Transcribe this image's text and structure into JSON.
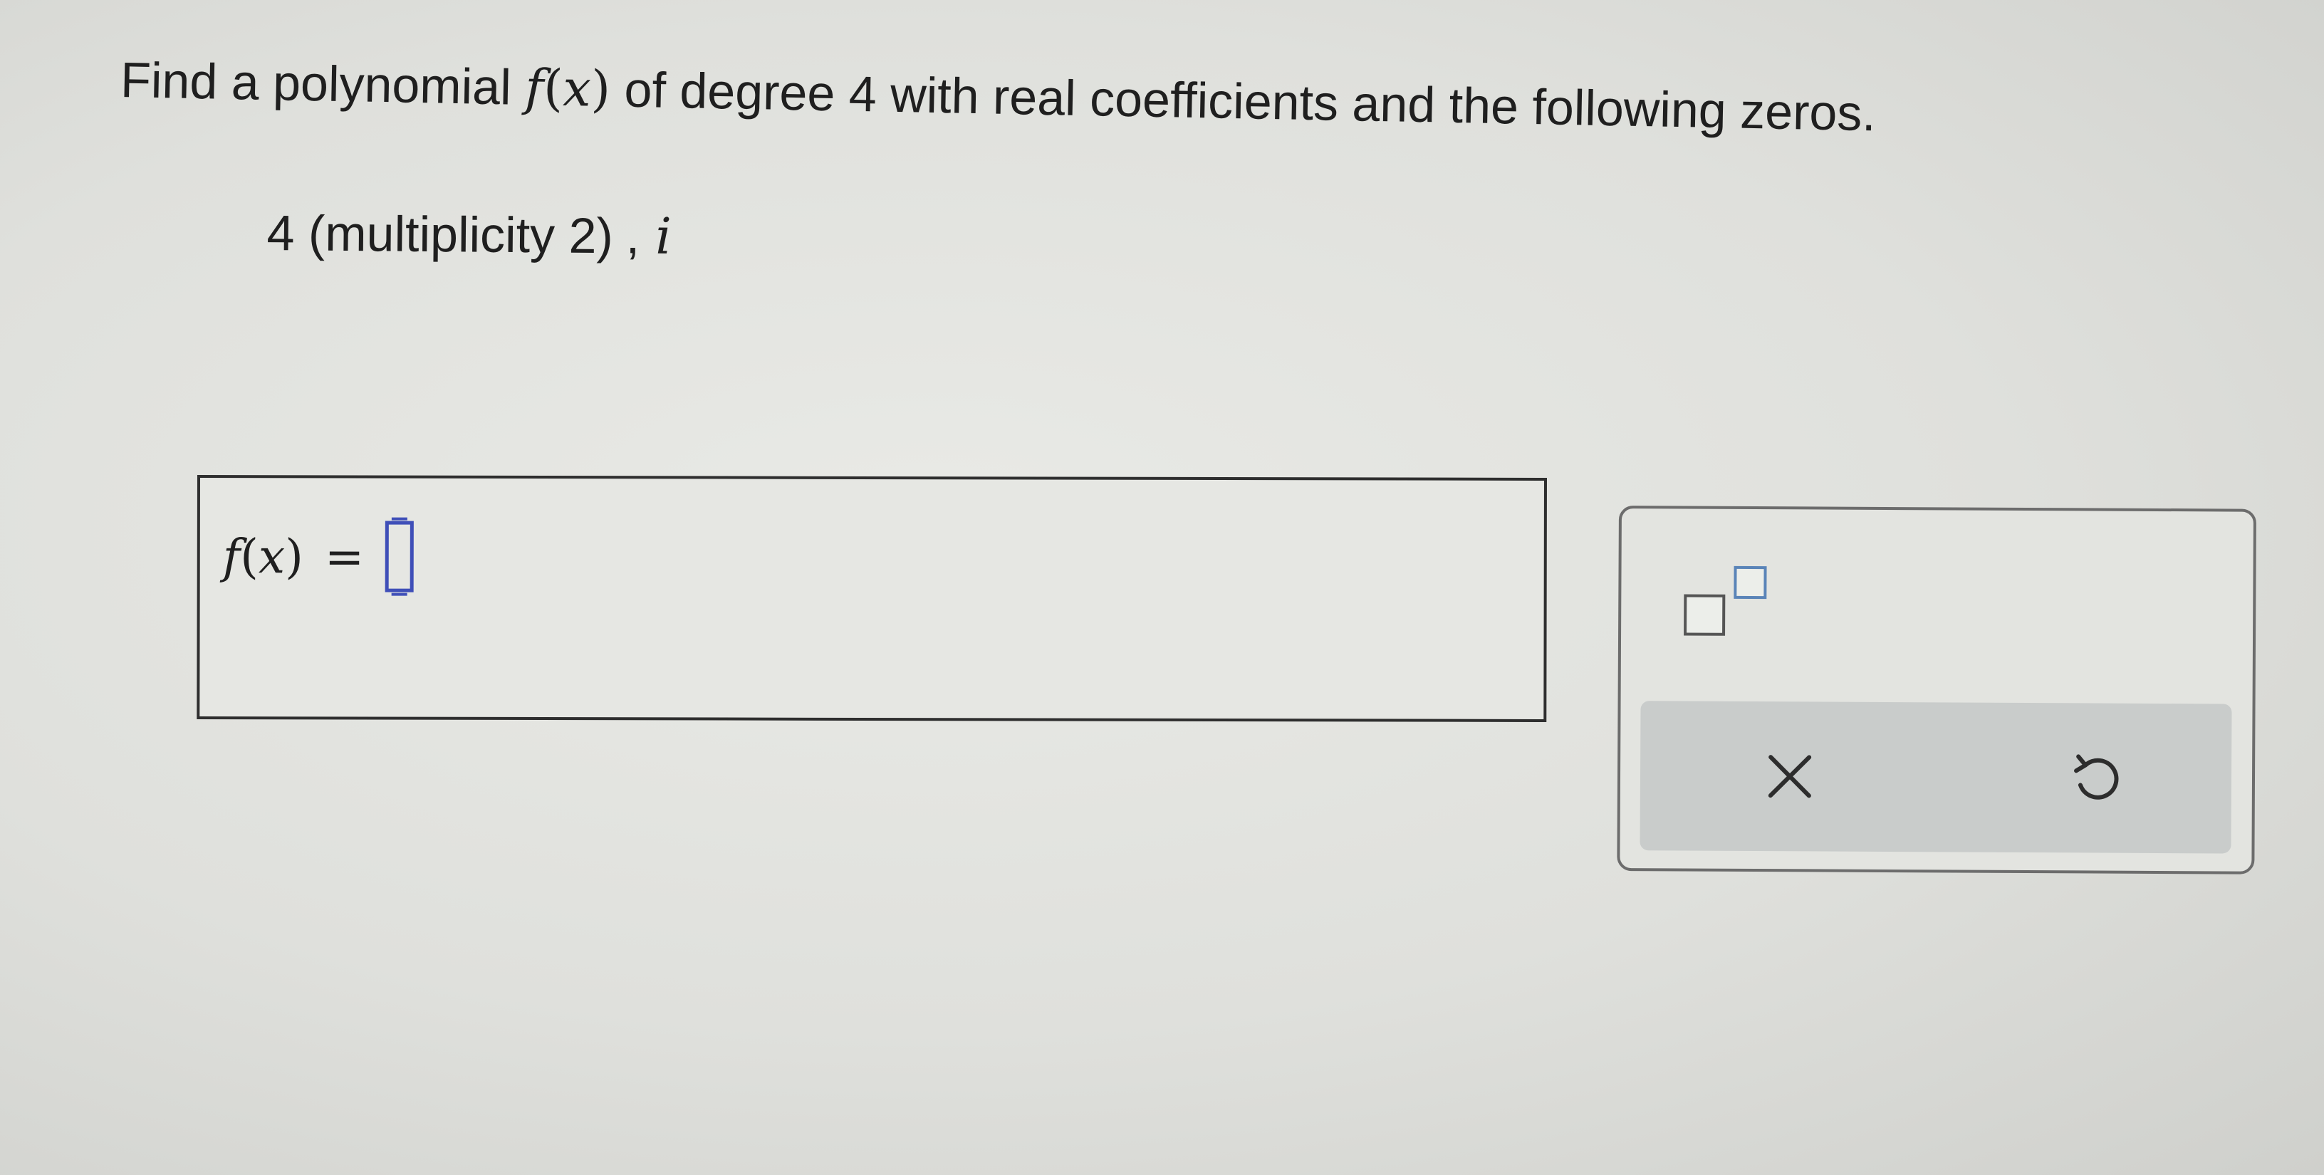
{
  "question": {
    "intro": "Find a polynomial",
    "func_name": "f",
    "var_name": "x",
    "rest": "of degree 4 with real coefficients and the following zeros."
  },
  "zeros": {
    "first": "4 (multiplicity 2)",
    "separator": ",",
    "second": "i"
  },
  "answer": {
    "func_name": "f",
    "var_name": "x",
    "equals": "=",
    "value": ""
  },
  "toolbar": {
    "exponent_icon": "superscript-template-icon",
    "clear_icon": "close-icon",
    "undo_icon": "undo-icon"
  },
  "colors": {
    "cursor": "#3f4fb8",
    "superscript_box": "#5a84b8",
    "action_bar": "#c9cccb"
  }
}
